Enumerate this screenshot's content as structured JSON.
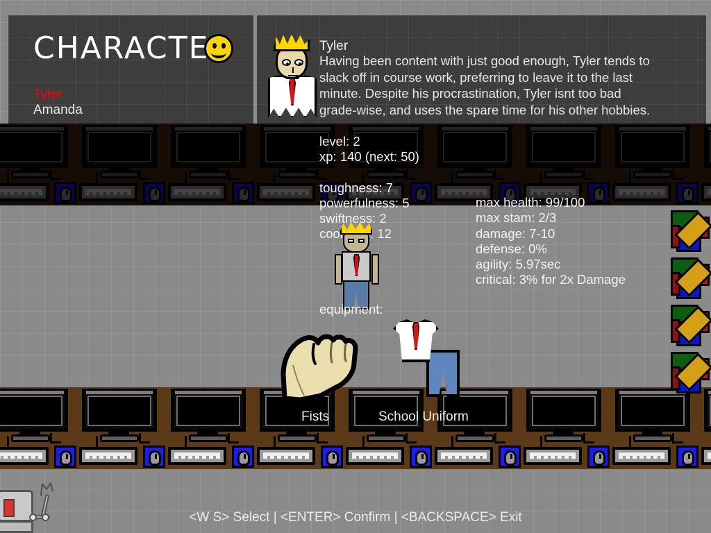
{
  "screen": {
    "title": "CHARACTER",
    "title_icon": "smiley-face-icon"
  },
  "roster": {
    "items": [
      {
        "name": "Tyler",
        "selected": true,
        "color": "#ff0000"
      },
      {
        "name": "Amanda",
        "selected": false,
        "color": "#e8e8e8"
      }
    ]
  },
  "character": {
    "portrait_icon": "tyler-portrait",
    "sprite_icon": "tyler-sprite",
    "name": "Tyler",
    "description": "Having been content with just good enough, Tyler tends to slack off in course work, preferring to leave it to the last minute. Despite his procrastination, Tyler isnt too bad grade-wise, and uses the spare time for his other hobbies.",
    "progress": {
      "level": "level: 2",
      "xp": "xp: 140 (next: 50)"
    },
    "attributes": [
      "toughness: 7",
      "powerfulness: 5",
      "swiftness: 2",
      "coolness: 12"
    ],
    "derived": [
      "max health: 99/100",
      "max stam: 2/3",
      "damage: 7-10",
      "defense: 0%",
      "agility: 5.97sec",
      "critical: 3% for 2x Damage"
    ]
  },
  "equipment": {
    "label": "equipment:",
    "slots": [
      {
        "name": "Fists",
        "icon": "fist-icon"
      },
      {
        "name": "School Uniform",
        "icon": "school-uniform-icon"
      }
    ]
  },
  "footer": {
    "hint": "<W S> Select | <ENTER> Confirm | <BACKSPACE> Exit"
  }
}
